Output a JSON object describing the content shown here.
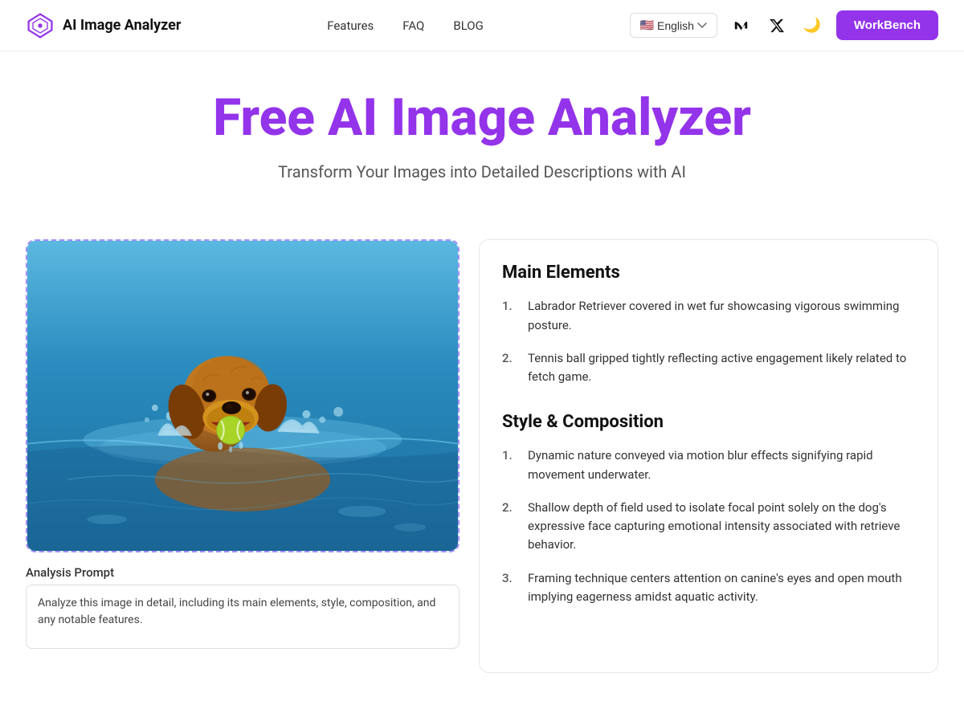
{
  "nav": {
    "logo_text": "AI Image Analyzer",
    "links": [
      {
        "label": "Features",
        "id": "features"
      },
      {
        "label": "FAQ",
        "id": "faq"
      },
      {
        "label": "BLOG",
        "id": "blog"
      }
    ],
    "lang_flag": "🇺🇸",
    "lang_label": "English",
    "workbench_label": "WorkBench"
  },
  "hero": {
    "title": "Free AI Image Analyzer",
    "subtitle": "Transform Your Images into Detailed Descriptions with AI"
  },
  "left": {
    "prompt_label": "Analysis Prompt",
    "prompt_value": "Analyze this image in detail, including its main elements, style, composition, and any notable features."
  },
  "right": {
    "sections": [
      {
        "title": "Main Elements",
        "items": [
          "Labrador Retriever covered in wet fur showcasing vigorous swimming posture.",
          "Tennis ball gripped tightly reflecting active engagement likely related to fetch game."
        ]
      },
      {
        "title": "Style & Composition",
        "items": [
          "Dynamic nature conveyed via motion blur effects signifying rapid movement underwater.",
          "Shallow depth of field used to isolate focal point solely on the dog's expressive face capturing emotional intensity associated with retrieve behavior.",
          "Framing technique centers attention on canine's eyes and open mouth implying eagerness amidst aquatic activity."
        ]
      }
    ]
  }
}
